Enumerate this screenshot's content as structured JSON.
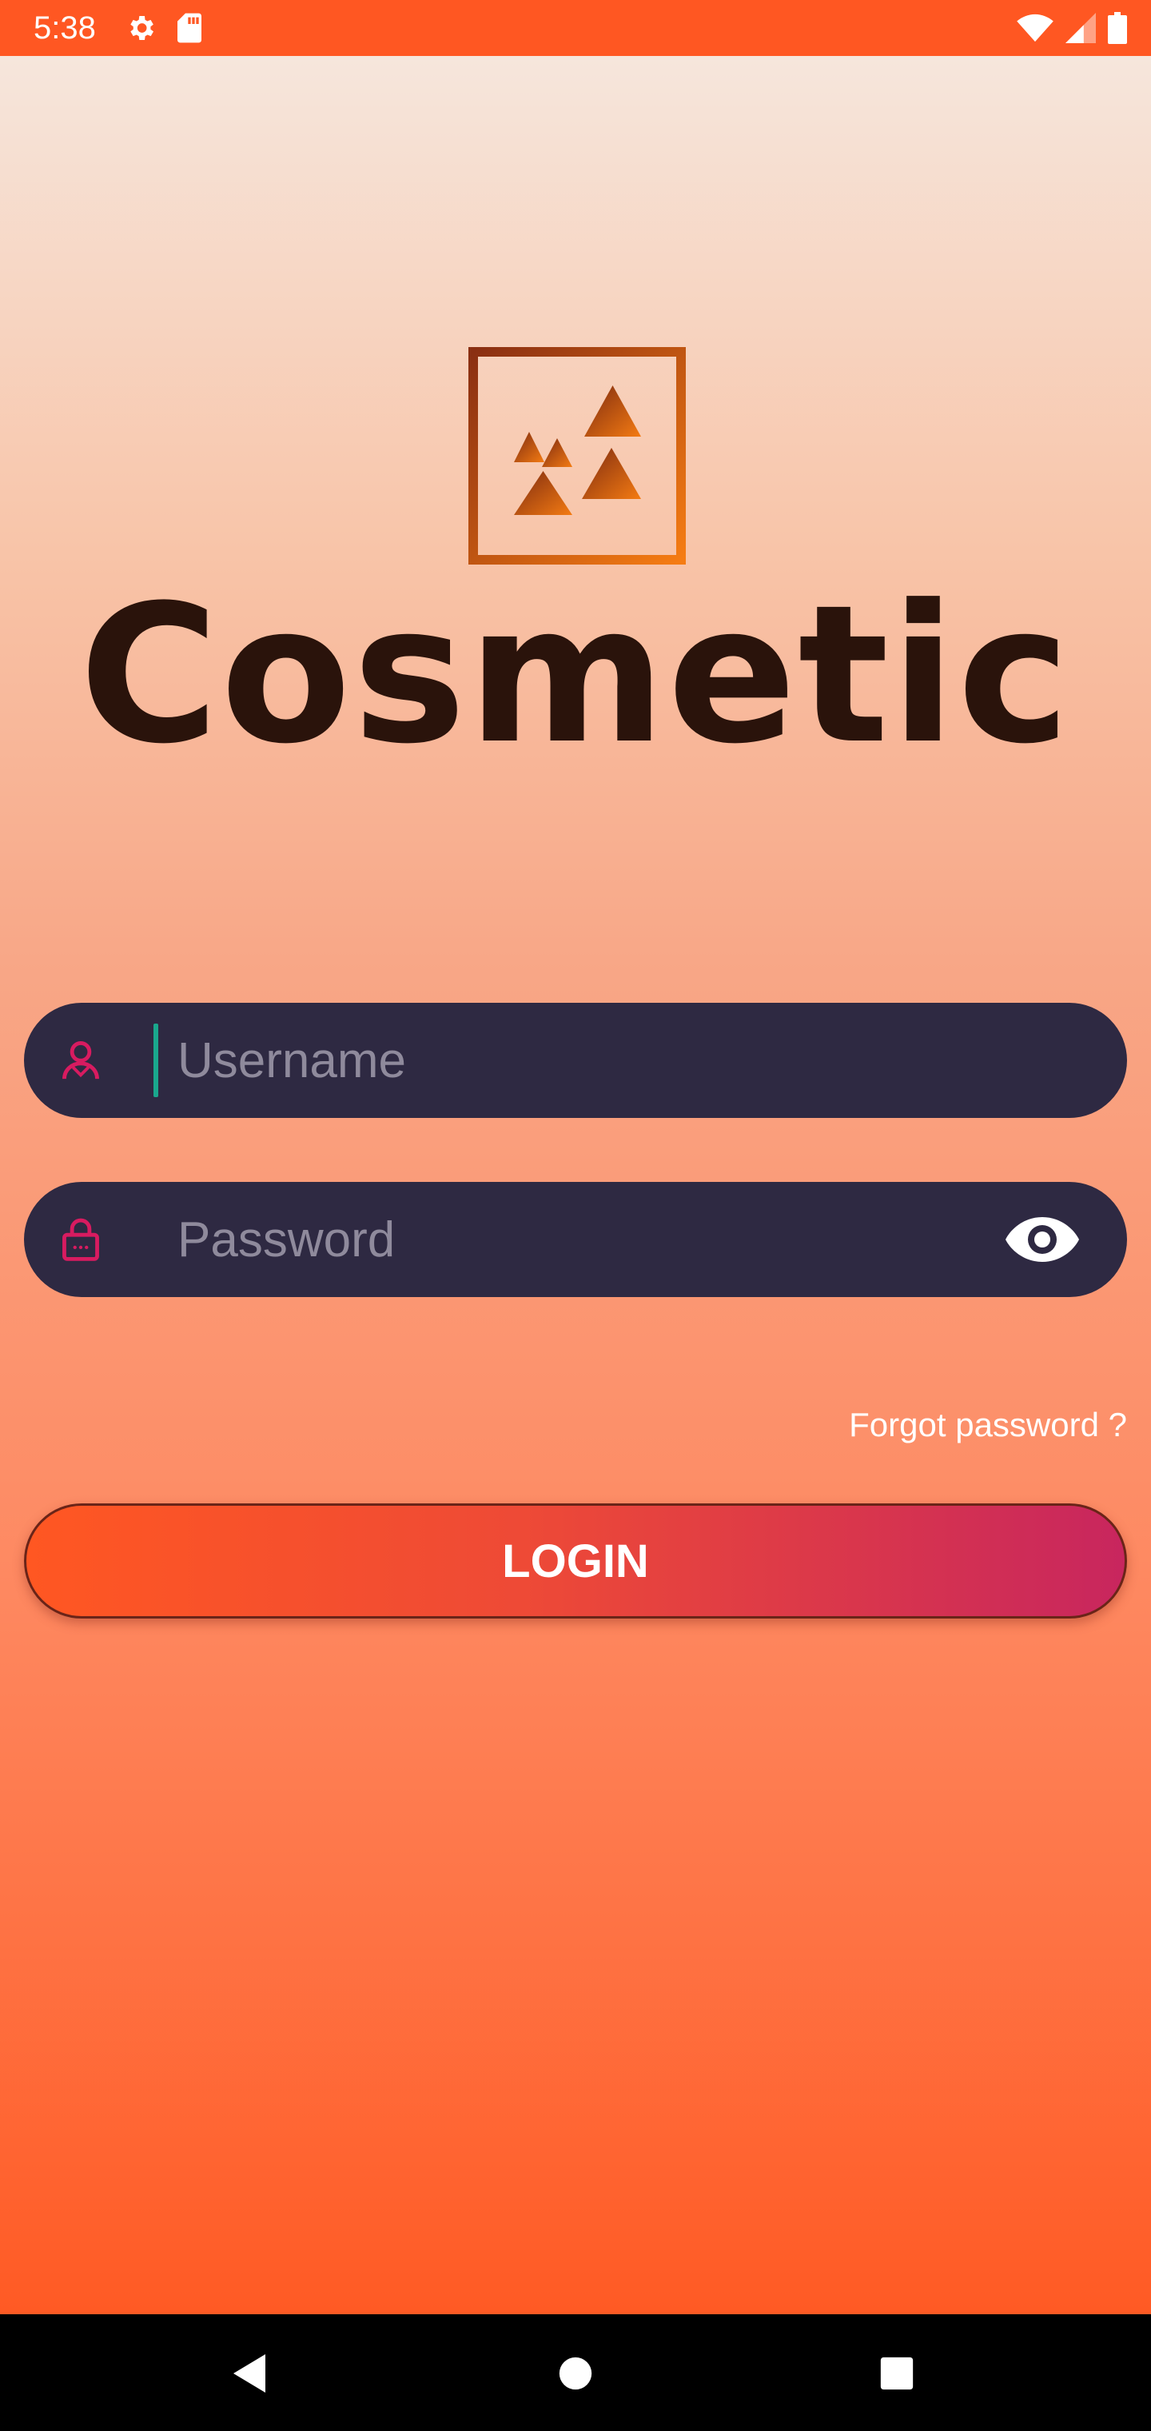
{
  "status_bar": {
    "time": "5:38",
    "left_icons": [
      "gear-icon",
      "sd-card-icon"
    ],
    "right_icons": [
      "wifi-icon",
      "cell-signal-icon",
      "battery-icon"
    ]
  },
  "app": {
    "brand": {
      "logo_icon": "triangles-logo-icon",
      "name": "Cosmetic"
    },
    "username": {
      "icon": "user-icon",
      "placeholder": "Username",
      "value": ""
    },
    "password": {
      "icon": "lock-icon",
      "placeholder": "Password",
      "value": "",
      "toggle_icon": "eye-icon"
    },
    "forgot_password_label": "Forgot password ?",
    "login_label": "LOGIN"
  },
  "nav_bar": {
    "buttons": [
      "back-icon",
      "home-icon",
      "recents-icon"
    ]
  },
  "colors": {
    "status_bar": "#ff5722",
    "field_background": "#2e2942",
    "icon_accent": "#d81b60",
    "caret": "#1aa78d",
    "login_gradient_start": "#ff5722",
    "login_gradient_end": "#c8265e",
    "brand_text": "#2a130b"
  }
}
